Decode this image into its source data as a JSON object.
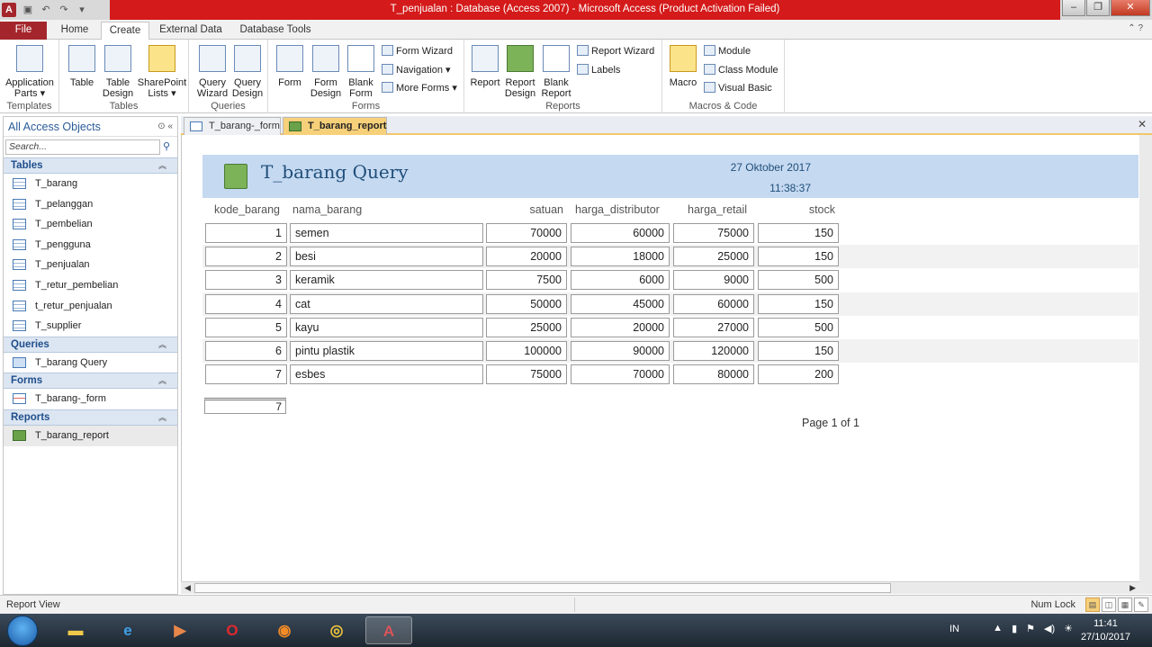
{
  "window": {
    "title": "T_penjualan : Database (Access 2007)  -  Microsoft Access (Product Activation Failed)",
    "app_icon_letter": "A"
  },
  "ribbon_tabs": [
    "File",
    "Home",
    "Create",
    "External Data",
    "Database Tools"
  ],
  "ribbon": {
    "templates": {
      "label": "Templates",
      "application_parts": "Application Parts"
    },
    "tables": {
      "label": "Tables",
      "table": "Table",
      "table_design": "Table Design",
      "sharepoint_lists": "SharePoint Lists"
    },
    "queries": {
      "label": "Queries",
      "query_wizard": "Query Wizard",
      "query_design": "Query Design"
    },
    "forms": {
      "label": "Forms",
      "form": "Form",
      "form_design": "Form Design",
      "blank_form": "Blank Form",
      "form_wizard": "Form Wizard",
      "navigation": "Navigation",
      "more_forms": "More Forms"
    },
    "reports": {
      "label": "Reports",
      "report": "Report",
      "report_design": "Report Design",
      "blank_report": "Blank Report",
      "report_wizard": "Report Wizard",
      "labels": "Labels"
    },
    "macros": {
      "label": "Macros & Code",
      "macro": "Macro",
      "module": "Module",
      "class_module": "Class Module",
      "visual_basic": "Visual Basic"
    }
  },
  "nav": {
    "header": "All Access Objects",
    "search_placeholder": "Search...",
    "sections": [
      {
        "title": "Tables",
        "items": [
          "T_barang",
          "T_pelanggan",
          "T_pembelian",
          "T_pengguna",
          "T_penjualan",
          "T_retur_pembelian",
          "t_retur_penjualan",
          "T_supplier"
        ]
      },
      {
        "title": "Queries",
        "items": [
          "T_barang Query"
        ]
      },
      {
        "title": "Forms",
        "items": [
          "T_barang-_form"
        ]
      },
      {
        "title": "Reports",
        "items": [
          "T_barang_report"
        ]
      }
    ]
  },
  "doc_tabs": [
    "T_barang-_form",
    "T_barang_report"
  ],
  "report": {
    "title": "T_barang Query",
    "date": "27 Oktober 2017",
    "time": "11:38:37",
    "columns": [
      "kode_barang",
      "nama_barang",
      "satuan",
      "harga_distributor",
      "harga_retail",
      "stock"
    ],
    "rows": [
      [
        "1",
        "semen",
        "70000",
        "60000",
        "75000",
        "150"
      ],
      [
        "2",
        "besi",
        "20000",
        "18000",
        "25000",
        "150"
      ],
      [
        "3",
        "keramik",
        "7500",
        "6000",
        "9000",
        "500"
      ],
      [
        "4",
        "cat",
        "50000",
        "45000",
        "60000",
        "150"
      ],
      [
        "5",
        "kayu",
        "25000",
        "20000",
        "27000",
        "500"
      ],
      [
        "6",
        "pintu plastik",
        "100000",
        "90000",
        "120000",
        "150"
      ],
      [
        "7",
        "esbes",
        "75000",
        "70000",
        "80000",
        "200"
      ]
    ],
    "count": "7",
    "page": "Page 1 of 1"
  },
  "status": {
    "view": "Report View",
    "num_lock": "Num Lock"
  },
  "taskbar": {
    "lang": "IN",
    "time": "11:41",
    "date": "27/10/2017"
  }
}
